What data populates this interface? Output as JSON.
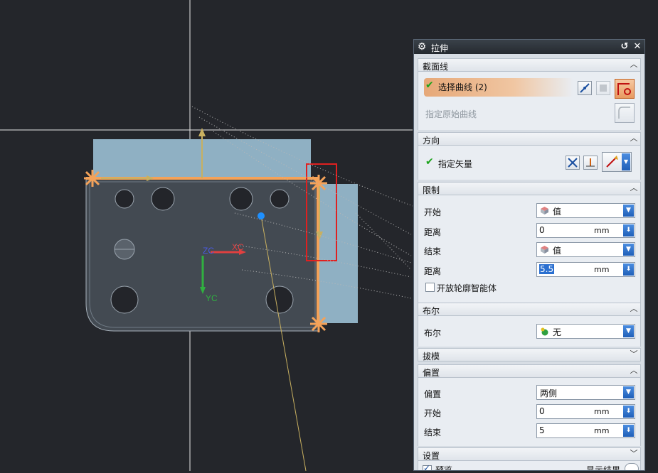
{
  "dialog": {
    "title": "拉伸",
    "sections": {
      "section": {
        "header": "截面线",
        "select_curve_label": "选择曲线 (2)",
        "specify_original_label": "指定原始曲线"
      },
      "direction": {
        "header": "方向",
        "specify_vector_label": "指定矢量"
      },
      "limits": {
        "header": "限制",
        "start_label": "开始",
        "start_option": "值",
        "start_distance_label": "距离",
        "start_distance_value": "0",
        "start_distance_unit": "mm",
        "end_label": "结束",
        "end_option": "值",
        "end_distance_label": "距离",
        "end_distance_value": "5.5",
        "end_distance_unit": "mm",
        "open_profile_label": "开放轮廓智能体"
      },
      "boolean": {
        "header": "布尔",
        "boolean_label": "布尔",
        "boolean_value": "无"
      },
      "draft": {
        "header": "拔模"
      },
      "offset": {
        "header": "偏置",
        "offset_label": "偏置",
        "offset_value": "两侧",
        "start_label": "开始",
        "start_value": "0",
        "start_unit": "mm",
        "end_label": "结束",
        "end_value": "5",
        "end_unit": "mm"
      },
      "settings": {
        "header": "设置"
      },
      "bottom": {
        "preview_label": "预览",
        "show_result_label": "显示结果"
      }
    }
  },
  "viewport": {
    "axis_labels": {
      "zc": "ZC",
      "xc": "XC",
      "yc": "YC"
    },
    "colors": {
      "background": "#24262b",
      "part": "#8fb0c3",
      "face": "#434a52",
      "orange": "#f4a259"
    }
  }
}
